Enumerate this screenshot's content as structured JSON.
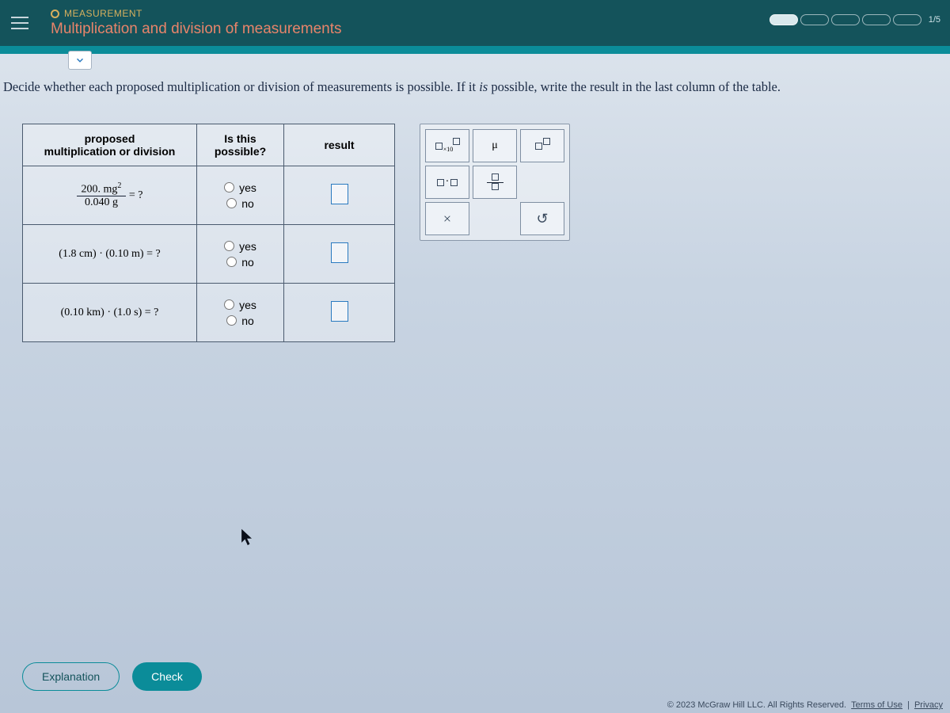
{
  "header": {
    "category": "MEASUREMENT",
    "title": "Multiplication and division of measurements",
    "progress_label": "1/5"
  },
  "instruction": {
    "pre": "Decide whether each proposed multiplication or division of measurements is possible. If it ",
    "em": "is",
    "post": " possible, write the result in the last column of the table."
  },
  "table": {
    "headers": {
      "c1a": "proposed",
      "c1b": "multiplication or division",
      "c2a": "Is this",
      "c2b": "possible?",
      "c3": "result"
    },
    "yes": "yes",
    "no": "no",
    "rows": [
      {
        "num": "200. mg",
        "num_exp": "2",
        "den": "0.040 g",
        "tail": " = ?"
      },
      {
        "plain": "(1.8 cm) · (0.10 m) = ?"
      },
      {
        "plain": "(0.10 km) · (1.0 s) = ?"
      }
    ]
  },
  "palette": {
    "mu": "μ",
    "x10": "×10",
    "dot": "·",
    "times": "×",
    "undo": "↺"
  },
  "buttons": {
    "explanation": "Explanation",
    "check": "Check"
  },
  "footer": {
    "copy": "© 2023 McGraw Hill LLC. All Rights Reserved.",
    "terms": "Terms of Use",
    "privacy": "Privacy"
  }
}
